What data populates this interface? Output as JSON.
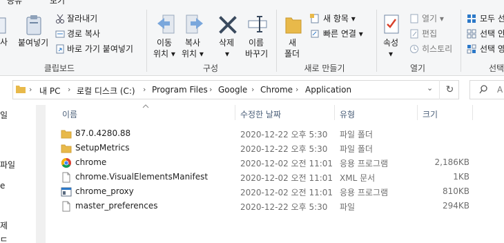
{
  "ribbon": {
    "top_tabs": [
      "공유",
      "보기"
    ],
    "clipboard": {
      "group_label": "클립보드",
      "cut_partial": "사",
      "paste": "붙여넣기",
      "cut": "잘라내기",
      "copy_path": "경로 복사",
      "paste_shortcut": "바로 가기 붙여넣기"
    },
    "organize": {
      "group_label": "구성",
      "move_to_1": "이동",
      "move_to_2": "위치 ▾",
      "copy_to_1": "복사",
      "copy_to_2": "위치 ▾",
      "delete_1": "삭제",
      "delete_2": "▾",
      "rename_1": "이름",
      "rename_2": "바꾸기"
    },
    "new": {
      "group_label": "새로 만들기",
      "new_folder_1": "새",
      "new_folder_2": "폴더",
      "new_item": "새 항목 ▾",
      "easy_access": "빠른 연결 ▾"
    },
    "open": {
      "group_label": "열기",
      "properties": "속성",
      "properties_arrow": "▾",
      "open": "열기 ▾",
      "edit": "편집",
      "history": "히스토리"
    },
    "select": {
      "group_label_partial": "선택",
      "select_all": "모두 선",
      "select_none": "선택 안",
      "invert": "선택 영"
    }
  },
  "address": {
    "crumbs": [
      "내 PC",
      "로컬 디스크 (C:)",
      "Program Files",
      "Google",
      "Chrome",
      "Application"
    ],
    "search_placeholder": "A"
  },
  "nav": {
    "items": [
      "일",
      "파일",
      "e",
      "제",
      "드"
    ]
  },
  "columns": {
    "name": "이름",
    "date": "수정한 날짜",
    "type": "유형",
    "size": "크기"
  },
  "files": [
    {
      "name": "87.0.4280.88",
      "date": "2020-12-22 오후 5:30",
      "type": "파일 폴더",
      "size": "",
      "icon": "folder-icon"
    },
    {
      "name": "SetupMetrics",
      "date": "2020-12-22 오후 5:30",
      "type": "파일 폴더",
      "size": "",
      "icon": "folder-icon"
    },
    {
      "name": "chrome",
      "date": "2020-12-02 오전 11:01",
      "type": "응용 프로그램",
      "size": "2,186KB",
      "icon": "chrome-icon"
    },
    {
      "name": "chrome.VisualElementsManifest",
      "date": "2020-12-02 오전 11:01",
      "type": "XML 문서",
      "size": "1KB",
      "icon": "document-icon"
    },
    {
      "name": "chrome_proxy",
      "date": "2020-12-02 오전 11:01",
      "type": "응용 프로그램",
      "size": "810KB",
      "icon": "app-window-icon"
    },
    {
      "name": "master_preferences",
      "date": "2020-12-22 오후 5:30",
      "type": "파일",
      "size": "294KB",
      "icon": "document-icon"
    }
  ],
  "colors": {
    "folder": "#e8b94a",
    "accent": "#2b78c8",
    "delete_x": "#3a4a5e"
  }
}
